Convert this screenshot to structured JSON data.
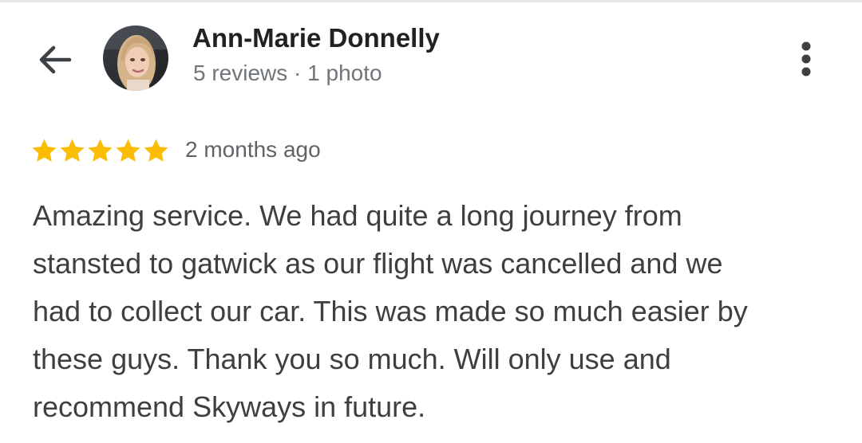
{
  "header": {
    "back_icon": "arrow-left-icon",
    "reviewer": {
      "name": "Ann-Marie Donnelly",
      "meta": "5 reviews · 1 photo",
      "avatar": "profile-photo"
    },
    "more_icon": "more-vertical-icon"
  },
  "review": {
    "rating": 5,
    "rating_max": 5,
    "star_color": "#fbbc04",
    "time": "2 months ago",
    "text": "Amazing service. We had quite a long journey from\nstansted to gatwick as our flight was cancelled and we\nhad to collect our car. This was made so much easier by\nthese guys. Thank you so much. Will only use and\nrecommend Skyways in future."
  }
}
